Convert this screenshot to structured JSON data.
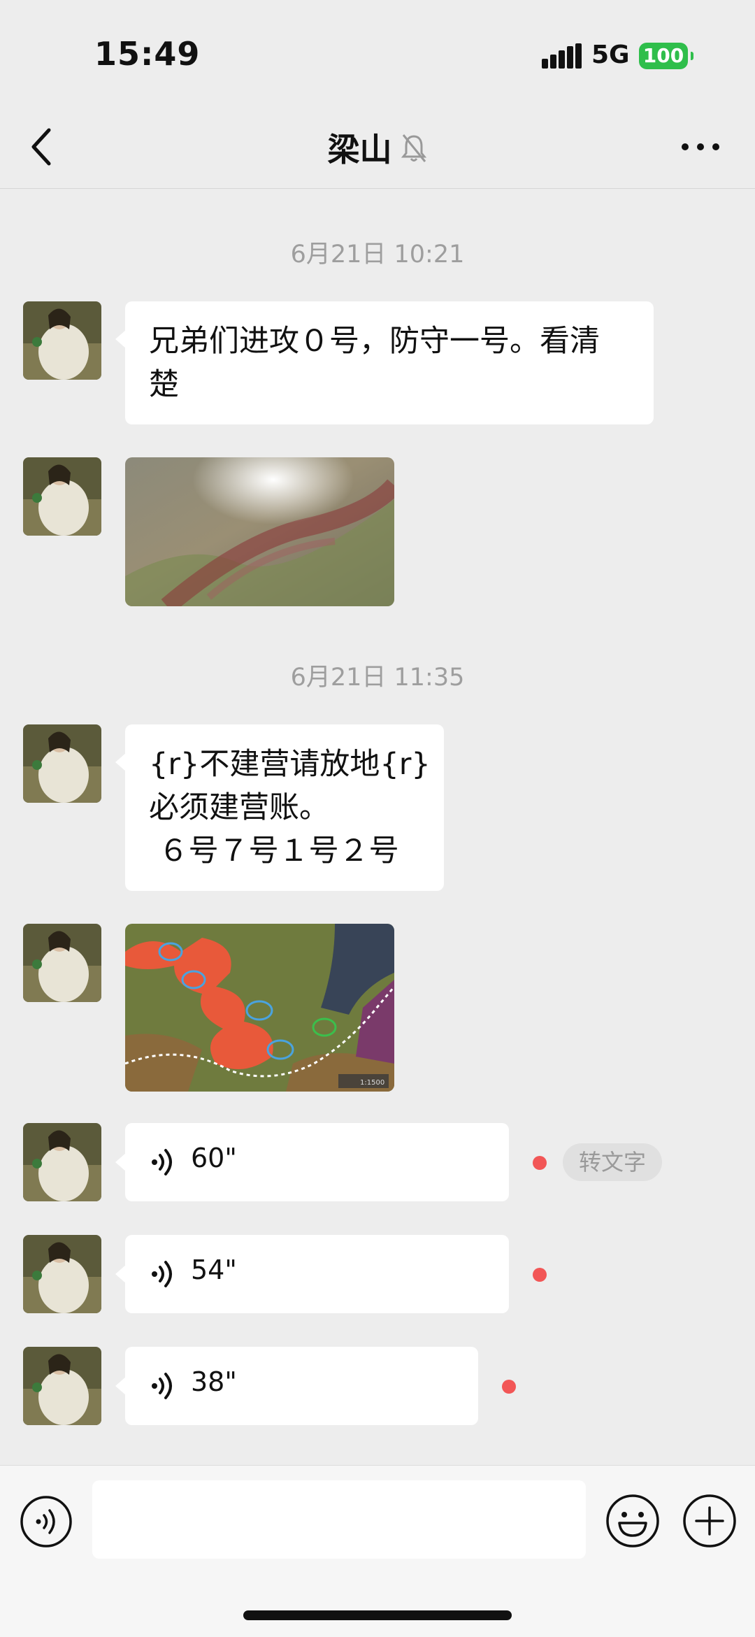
{
  "status_bar": {
    "time": "15:49",
    "network": "5G",
    "battery": "100"
  },
  "nav": {
    "title": "梁山",
    "back_icon": "chevron-left-icon",
    "mute_icon": "bell-off-icon",
    "more_icon": "more-dots-icon"
  },
  "messages": [
    {
      "type": "timestamp",
      "text": "6月21日 10:21"
    },
    {
      "type": "text",
      "lines": [
        "兄弟们进攻０号，防守一号。看清",
        "楚"
      ]
    },
    {
      "type": "image",
      "description": "blurred map screenshot"
    },
    {
      "type": "timestamp",
      "text": "6月21日 11:35"
    },
    {
      "type": "text",
      "lines": [
        "{r}不建营请放地{r}",
        "必须建营账。",
        " ６号７号１号２号"
      ]
    },
    {
      "type": "image",
      "description": "game map screenshot",
      "map_scale": "1:1500"
    },
    {
      "type": "voice",
      "duration": "60\"",
      "unread": true,
      "to_text": "转文字"
    },
    {
      "type": "voice",
      "duration": "54\"",
      "unread": true
    },
    {
      "type": "voice",
      "duration": "38\"",
      "unread": true
    }
  ],
  "colors": {
    "background": "#ededed",
    "bubble": "#ffffff",
    "unread_dot": "#f25656",
    "battery": "#2fbe4b"
  },
  "input_bar": {
    "voice_icon": "voice-mode-icon",
    "emoji_icon": "emoji-icon",
    "plus_icon": "plus-icon"
  }
}
